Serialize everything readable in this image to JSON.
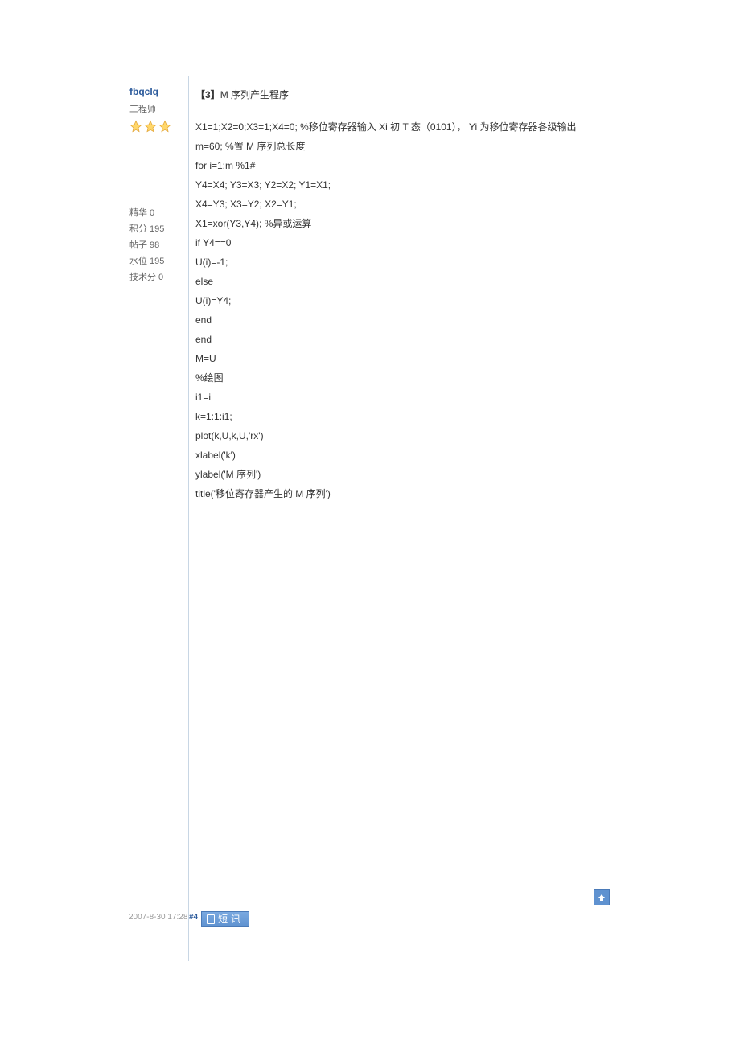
{
  "author": {
    "username": "fbqclq",
    "role": "工程师",
    "stars": 3,
    "stats": [
      {
        "label": "精华",
        "value": "0"
      },
      {
        "label": "积分",
        "value": "195"
      },
      {
        "label": "帖子",
        "value": "98"
      },
      {
        "label": "水位",
        "value": "195"
      },
      {
        "label": "技术分",
        "value": "0"
      }
    ]
  },
  "post": {
    "title_prefix": "【3】",
    "title_text": "M 序列产生程序",
    "lines": [
      "X1=1;X2=0;X3=1;X4=0; %移位寄存器输入 Xi 初 T 态（0101），             Yi 为移位寄存器各级输出",
      "m=60; %置 M 序列总长度",
      "for i=1:m %1#",
      "Y4=X4; Y3=X3; Y2=X2; Y1=X1;",
      "X4=Y3; X3=Y2; X2=Y1;",
      "X1=xor(Y3,Y4); %异或运算",
      "if Y4==0",
      "U(i)=-1;",
      "else",
      "U(i)=Y4;",
      "end",
      "end",
      "M=U",
      "%绘图",
      "i1=i",
      "k=1:1:i1;",
      "plot(k,U,k,U,'rx')",
      "xlabel('k')",
      "ylabel('M 序列')",
      "title('移位寄存器产生的 M 序列')"
    ]
  },
  "footer": {
    "timestamp": "2007-8-30 17:28",
    "floor": "#4",
    "message_label": "短讯"
  }
}
